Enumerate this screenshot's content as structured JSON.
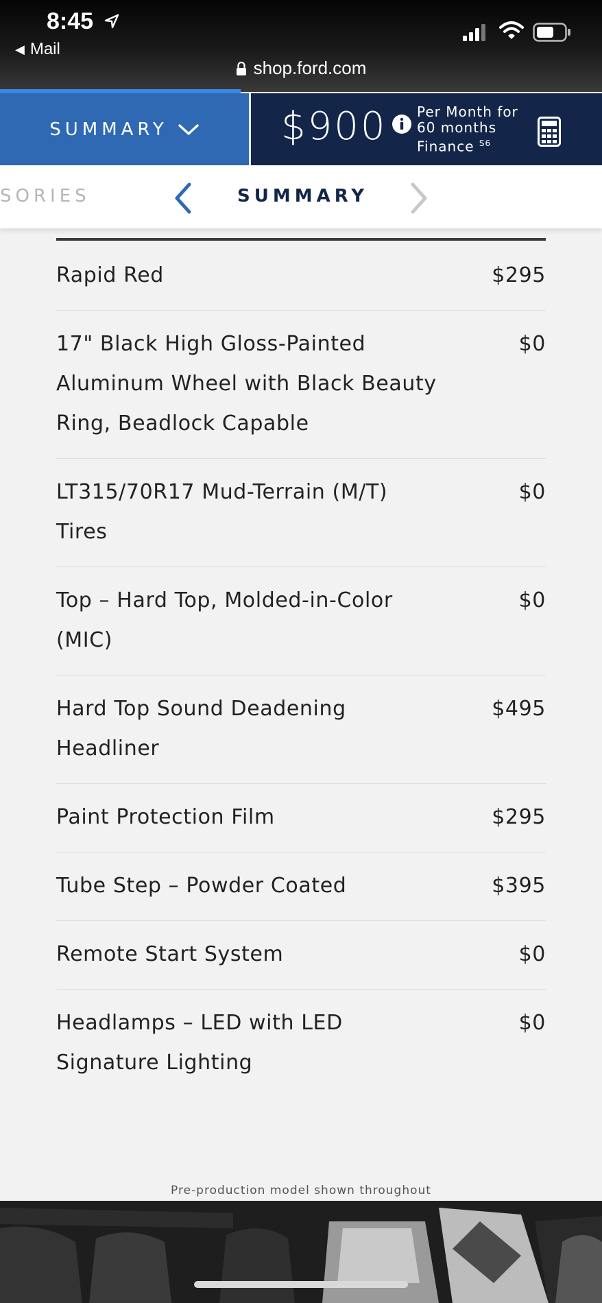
{
  "status_bar": {
    "time": "8:45",
    "back_app": "Mail",
    "url": "shop.ford.com"
  },
  "loading_progress": 0.4,
  "header": {
    "summary_label": "SUMMARY",
    "price": "$900",
    "finance_line1": "Per Month for",
    "finance_line2": "60 months",
    "finance_line3": "Finance",
    "finance_footnote": "S6"
  },
  "section_tabs": {
    "previous_label": "SORIES",
    "current_label": "SUMMARY"
  },
  "line_items": [
    {
      "name": "Rapid Red",
      "price": "$295"
    },
    {
      "name": "17\" Black High Gloss-Painted Aluminum Wheel with Black Beauty Ring, Beadlock Capable",
      "price": "$0"
    },
    {
      "name": "LT315/70R17 Mud-Terrain (M/T) Tires",
      "price": "$0"
    },
    {
      "name": "Top – Hard Top, Molded-in-Color (MIC)",
      "price": "$0"
    },
    {
      "name": "Hard Top Sound Deadening Headliner",
      "price": "$495"
    },
    {
      "name": "Paint Protection Film",
      "price": "$295"
    },
    {
      "name": "Tube Step – Powder Coated",
      "price": "$395"
    },
    {
      "name": "Remote Start System",
      "price": "$0"
    },
    {
      "name": "Headlamps – LED with LED Signature Lighting",
      "price": "$0"
    }
  ],
  "disclaimer": "Pre-production model shown throughout",
  "colors": {
    "summary_blue": "#2f68b3",
    "finance_navy": "#13264a",
    "progress_blue": "#3f87e6",
    "page_bg": "#f2f2f2"
  }
}
